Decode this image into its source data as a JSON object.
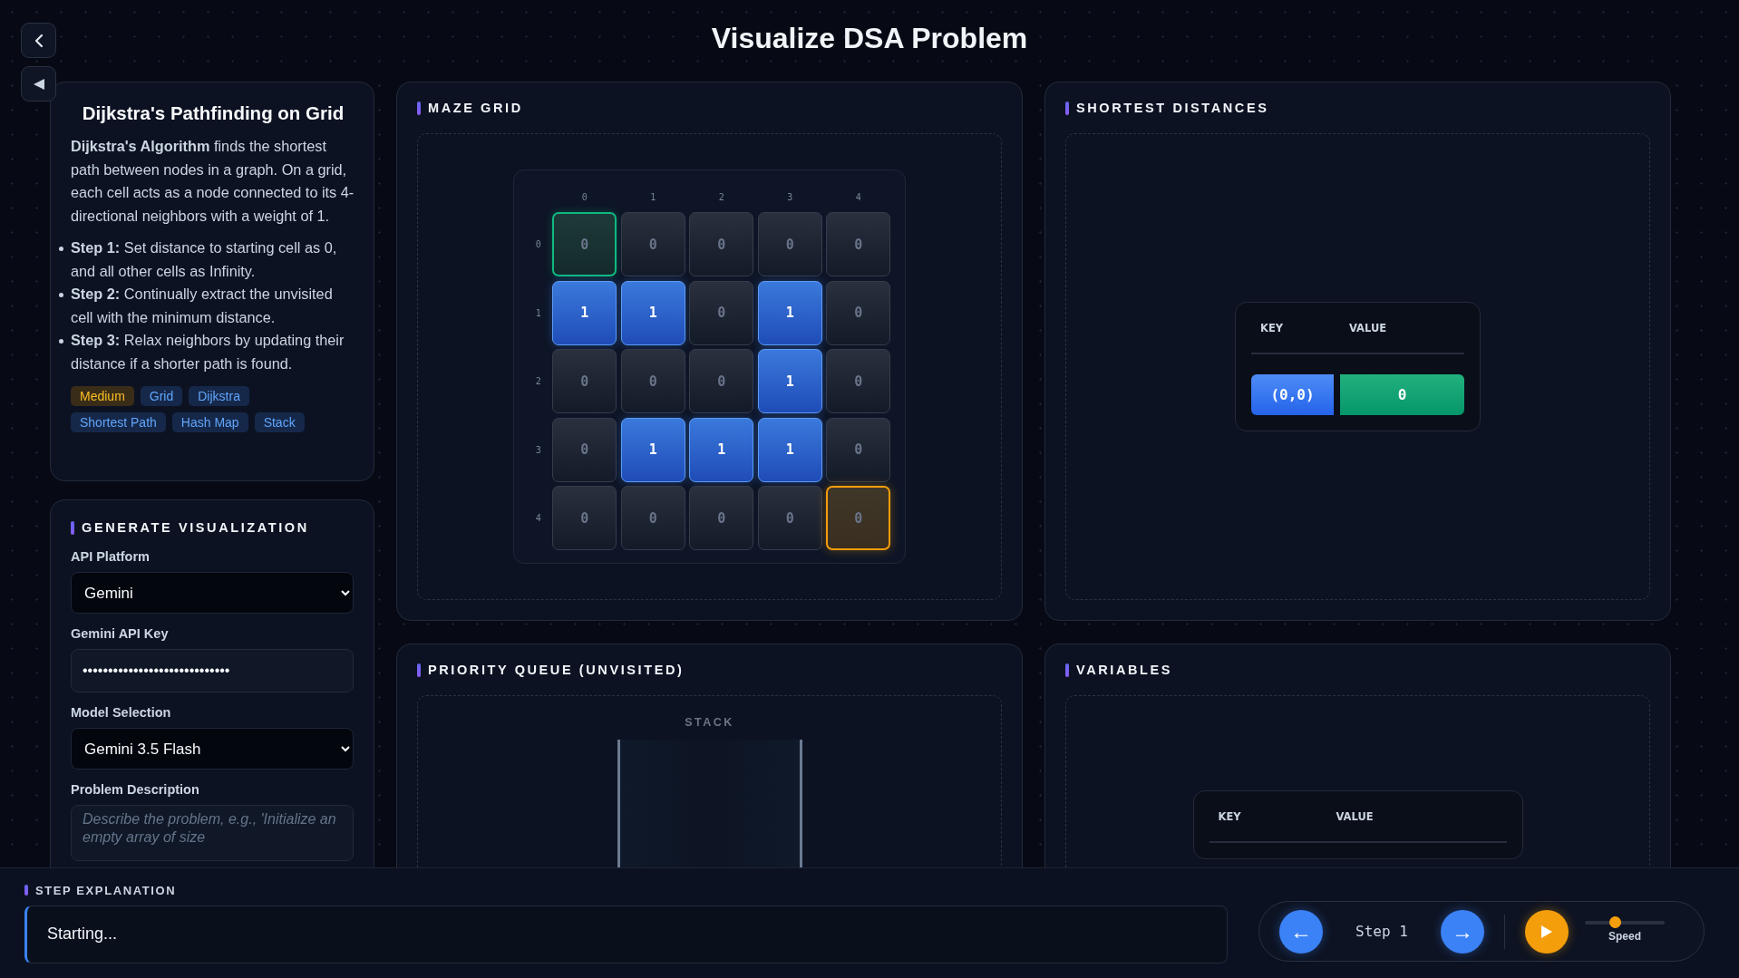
{
  "header": {
    "title": "Visualize DSA Problem"
  },
  "nav_buttons": [
    {
      "kind": "back"
    },
    {
      "kind": "collapse"
    }
  ],
  "problem": {
    "title": "Dijkstra's Pathfinding on Grid",
    "description": "**Dijkstra's Algorithm** finds the shortest path between nodes in a graph. On a grid, each cell acts as a node connected to its 4-directional neighbors with a weight of 1.",
    "steps": [
      "**Step 1:** Set distance to starting cell as 0, and all other cells as Infinity.",
      "**Step 2:** Continually extract the unvisited cell with the minimum distance.",
      "**Step 3:** Relax neighbors by updating their distance if a shorter path is found."
    ],
    "tags": [
      {
        "label": "Medium",
        "kind": "difficulty"
      },
      {
        "label": "Grid",
        "kind": "topic"
      },
      {
        "label": "Dijkstra",
        "kind": "topic"
      },
      {
        "label": "Shortest Path",
        "kind": "topic"
      },
      {
        "label": "Hash Map",
        "kind": "topic"
      },
      {
        "label": "Stack",
        "kind": "topic"
      }
    ]
  },
  "generate": {
    "title": "GENERATE VISUALIZATION",
    "fields": [
      {
        "kind": "select",
        "label": "API Platform",
        "value": "Gemini"
      },
      {
        "kind": "secret",
        "label": "Gemini API Key",
        "value": "•••••••••••••••••••••••••••••"
      },
      {
        "kind": "select",
        "label": "Model Selection",
        "value": "Gemini 3.5 Flash"
      },
      {
        "kind": "textarea",
        "label": "Problem Description",
        "placeholder": "Describe the problem, e.g., 'Initialize an empty array of size"
      }
    ]
  },
  "maze": {
    "title": "MAZE GRID",
    "columns": [
      "0",
      "1",
      "2",
      "3",
      "4"
    ],
    "rows": [
      {
        "label": "0",
        "cells": [
          {
            "value": "0",
            "kind": "start"
          },
          {
            "value": "0",
            "kind": "open"
          },
          {
            "value": "0",
            "kind": "open"
          },
          {
            "value": "0",
            "kind": "open"
          },
          {
            "value": "0",
            "kind": "open"
          }
        ]
      },
      {
        "label": "1",
        "cells": [
          {
            "value": "1",
            "kind": "wall"
          },
          {
            "value": "1",
            "kind": "wall"
          },
          {
            "value": "0",
            "kind": "open"
          },
          {
            "value": "1",
            "kind": "wall"
          },
          {
            "value": "0",
            "kind": "open"
          }
        ]
      },
      {
        "label": "2",
        "cells": [
          {
            "value": "0",
            "kind": "open"
          },
          {
            "value": "0",
            "kind": "open"
          },
          {
            "value": "0",
            "kind": "open"
          },
          {
            "value": "1",
            "kind": "wall"
          },
          {
            "value": "0",
            "kind": "open"
          }
        ]
      },
      {
        "label": "3",
        "cells": [
          {
            "value": "0",
            "kind": "open"
          },
          {
            "value": "1",
            "kind": "wall"
          },
          {
            "value": "1",
            "kind": "wall"
          },
          {
            "value": "1",
            "kind": "wall"
          },
          {
            "value": "0",
            "kind": "open"
          }
        ]
      },
      {
        "label": "4",
        "cells": [
          {
            "value": "0",
            "kind": "open"
          },
          {
            "value": "0",
            "kind": "open"
          },
          {
            "value": "0",
            "kind": "open"
          },
          {
            "value": "0",
            "kind": "open"
          },
          {
            "value": "0",
            "kind": "end"
          }
        ]
      }
    ]
  },
  "distances": {
    "title": "SHORTEST DISTANCES",
    "headers": [
      "KEY",
      "VALUE"
    ],
    "rows": [
      {
        "key": "(0,0)",
        "value": "0"
      }
    ]
  },
  "queue": {
    "title": "PRIORITY QUEUE (UNVISITED)",
    "stack_label": "STACK"
  },
  "variables": {
    "title": "VARIABLES",
    "headers": [
      "KEY",
      "VALUE"
    ]
  },
  "step": {
    "label": "STEP EXPLANATION",
    "text": "Starting..."
  },
  "controls": {
    "prev": "←",
    "step": "Step 1",
    "next": "→",
    "speed_label": "Speed",
    "speed": {
      "level": 0.38
    }
  }
}
